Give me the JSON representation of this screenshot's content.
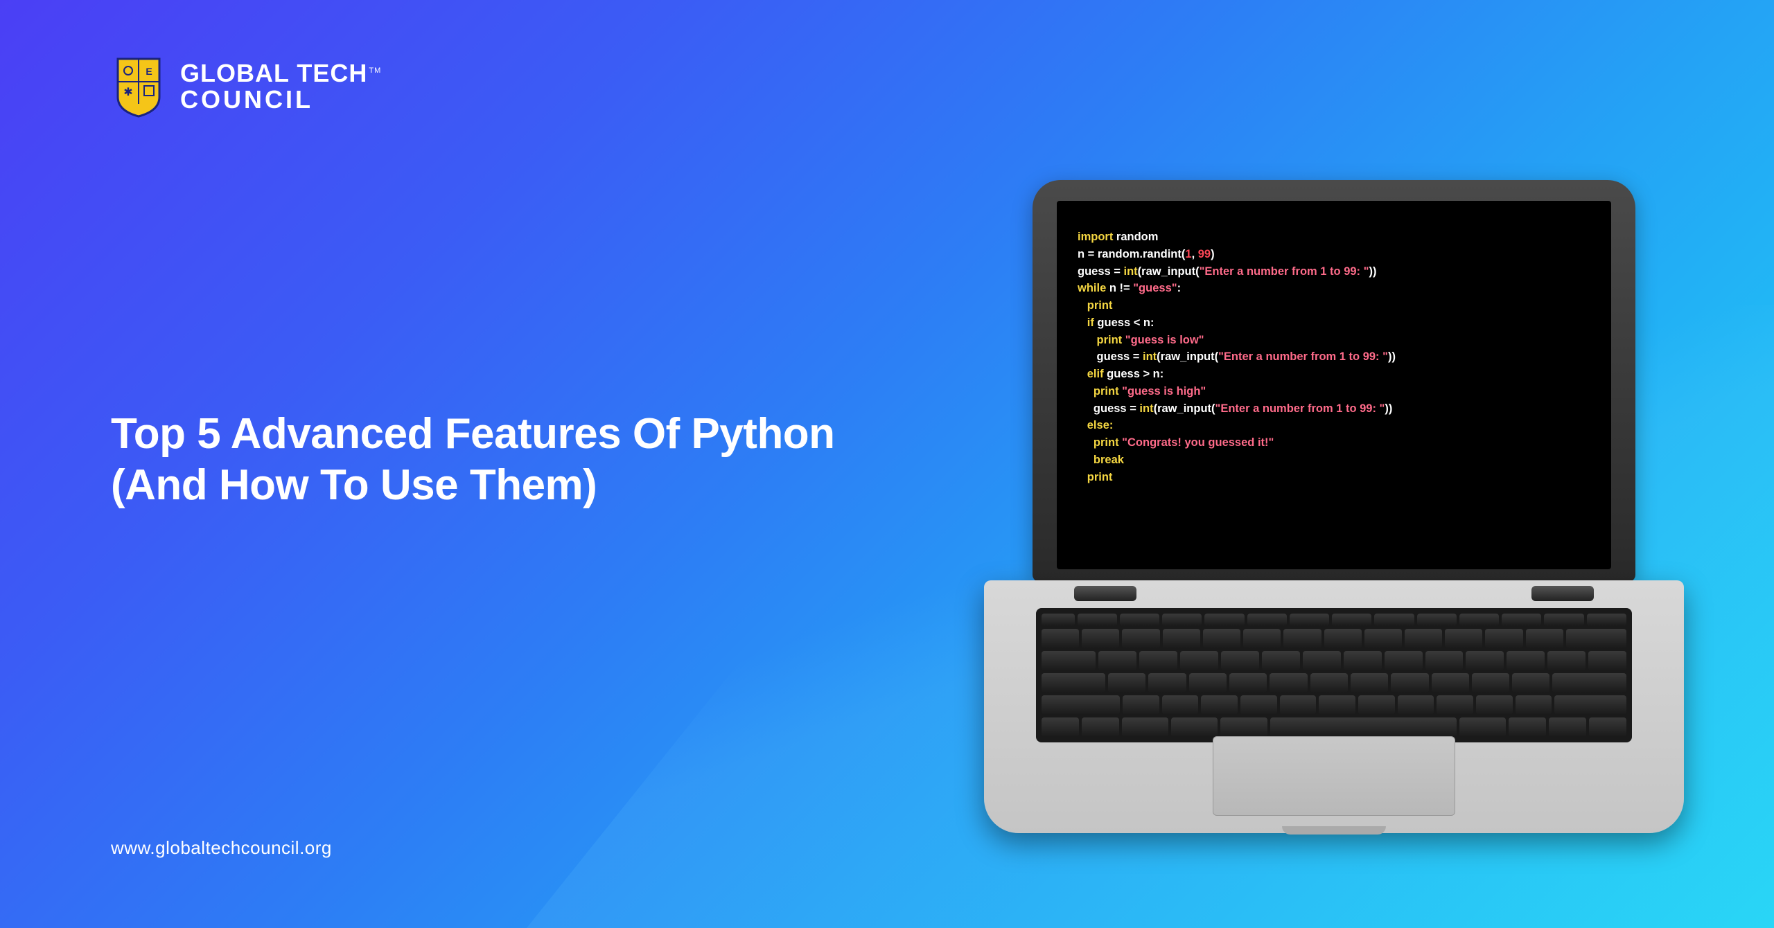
{
  "brand": {
    "line1": "GLOBAL TECH",
    "line2": "COUNCIL",
    "tm": "TM"
  },
  "title": {
    "line1": "Top 5 Advanced Features Of Python",
    "line2": "(And How To Use Them)"
  },
  "footer": {
    "url": "www.globaltechcouncil.org"
  },
  "code": {
    "l1_kw": "import",
    "l1_rest": " random",
    "l2_a": "n = random.randint(",
    "l2_n1": "1",
    "l2_c": ", ",
    "l2_n2": "99",
    "l2_b": ")",
    "l3_a": "guess = ",
    "l3_fn": "int",
    "l3_b": "(raw_input(",
    "l3_s": "\"Enter a number from 1 to 99: \"",
    "l3_c": "))",
    "l4_kw": "while",
    "l4_a": " n != ",
    "l4_s": "\"guess\"",
    "l4_b": ":",
    "l5": "   print",
    "l6_kw": "   if",
    "l6_a": " guess < n:",
    "l7_kw": "      print ",
    "l7_s": "\"guess is low\"",
    "l8_a": "      guess = ",
    "l8_fn": "int",
    "l8_b": "(raw_input(",
    "l8_s": "\"Enter a number from 1 to 99: \"",
    "l8_c": "))",
    "l9_kw": "   elif",
    "l9_a": " guess > n:",
    "l10_kw": "     print ",
    "l10_s": "\"guess is high\"",
    "l11_a": "     guess = ",
    "l11_fn": "int",
    "l11_b": "(raw_input(",
    "l11_s": "\"Enter a number from 1 to 99: \"",
    "l11_c": "))",
    "l12_kw": "   else:",
    "l13_kw": "     print ",
    "l13_s": "\"Congrats! you guessed it!\"",
    "l14_kw": "     break",
    "l15": "   print"
  }
}
